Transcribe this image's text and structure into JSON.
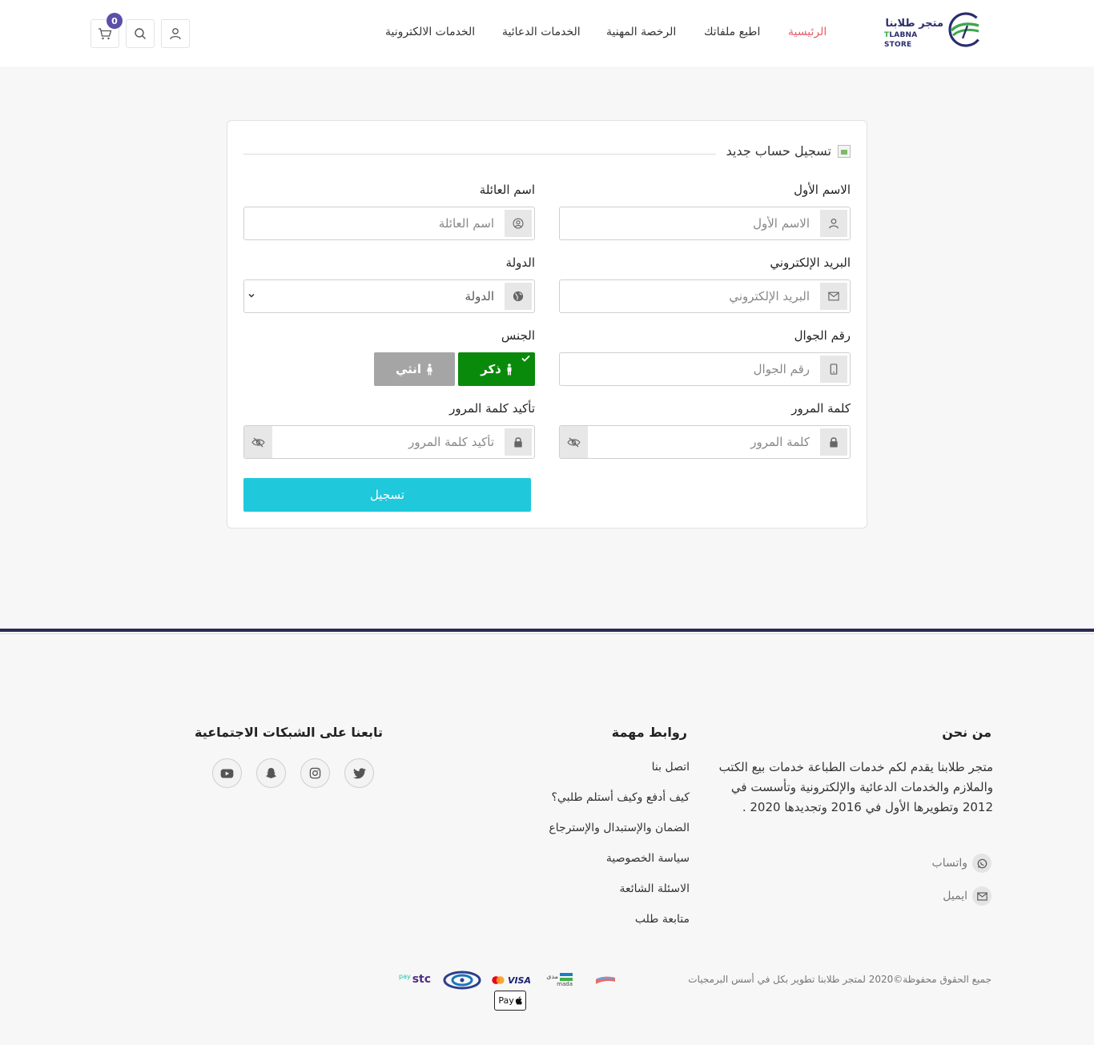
{
  "header": {
    "logo": {
      "name_ar": "متجر طلابنا",
      "name_en_prefix": "T",
      "name_en_rest": "LABNA STORE"
    },
    "nav": [
      {
        "label": "الرئيسية",
        "active": true
      },
      {
        "label": "اطبع ملفاتك"
      },
      {
        "label": "الرخصة المهنية"
      },
      {
        "label": "الخدمات الدعائية"
      },
      {
        "label": "الخدمات الالكترونية"
      }
    ],
    "cart_count": "0",
    "icons": [
      "user-icon",
      "search-icon",
      "cart-icon"
    ]
  },
  "form": {
    "title": "تسجيل حساب جديد",
    "first_name": {
      "label": "الاسم الأول",
      "placeholder": "الاسم الأول"
    },
    "last_name": {
      "label": "اسم العائلة",
      "placeholder": "اسم العائلة"
    },
    "email": {
      "label": "البريد الإلكتروني",
      "placeholder": "البريد الإلكتروني"
    },
    "country": {
      "label": "الدولة",
      "value": "الدولة"
    },
    "mobile": {
      "label": "رقم الجوال",
      "placeholder": "رقم الجوال"
    },
    "gender": {
      "label": "الجنس",
      "male": "ذكر",
      "female": "انثي",
      "selected": "male"
    },
    "password": {
      "label": "كلمة المرور",
      "placeholder": "كلمة المرور"
    },
    "confirm_password": {
      "label": "تأكيد كلمة المرور",
      "placeholder": "تأكيد كلمة المرور"
    },
    "submit": "تسجيل"
  },
  "footer": {
    "about": {
      "heading": "من نحن",
      "text": "متجر طلابنا يقدم لكم خدمات الطباعة خدمات بيع الكتب والملازم والخدمات الدعائية والإلكترونية وتأسست في 2012 وتطويرها الأول في 2016 وتجديدها 2020 .",
      "whatsapp": "واتساب",
      "email": "ايميل"
    },
    "links": {
      "heading": "روابط مهمة",
      "items": [
        "اتصل بنا",
        "كيف أدفع وكيف أستلم طلبي؟",
        "الضمان والإستبدال والإسترجاع",
        "سياسة الخصوصية",
        "الاسئلة الشائعة",
        "متابعة طلب"
      ]
    },
    "social": {
      "heading": "تابعنا على الشبكات الاجتماعية",
      "icons": [
        "twitter-icon",
        "instagram-icon",
        "snapchat-icon",
        "youtube-icon"
      ]
    },
    "copyright": "جميع الحقوق محفوظة©2020 لمتجر طلابنا تطوير بكل في أسس البرمجيات",
    "payments": {
      "stc": "stc",
      "stc_pay": "pay",
      "visa": "VISA",
      "mada_ar": "مدى",
      "mada_en": "mada",
      "apple_pay": "Pay"
    }
  },
  "colors": {
    "accent": "#e65d6a",
    "brand": "#2b2d6e",
    "submit": "#1fc8db",
    "male": "#0a8a0a",
    "female": "#a5a5a5",
    "badge": "#5b4fa8"
  }
}
